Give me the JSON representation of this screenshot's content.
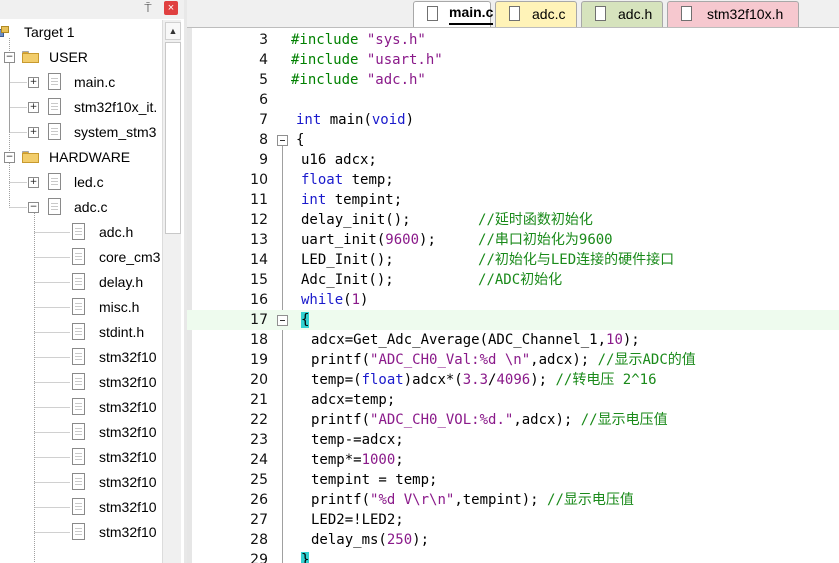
{
  "project_panel": {
    "pin_glyph": "⍑",
    "close_glyph": "×",
    "target": "Target 1",
    "groups": [
      {
        "name": "USER",
        "files": [
          "main.c",
          "stm32f10x_it.",
          "system_stm3"
        ]
      },
      {
        "name": "HARDWARE",
        "files": [
          "led.c",
          "adc.c"
        ]
      }
    ],
    "adc_children": [
      "adc.h",
      "core_cm3",
      "delay.h",
      "misc.h",
      "stdint.h",
      "stm32f10",
      "stm32f10",
      "stm32f10",
      "stm32f10",
      "stm32f10",
      "stm32f10",
      "stm32f10",
      "stm32f10"
    ]
  },
  "tabs": [
    {
      "label": "main.c",
      "active": true,
      "color": "#ffffff"
    },
    {
      "label": "adc.c",
      "active": false,
      "color": "#fff3b8"
    },
    {
      "label": "adc.h",
      "active": false,
      "color": "#d6e3bd"
    },
    {
      "label": "stm32f10x.h",
      "active": false,
      "color": "#f6c8cf"
    }
  ],
  "editor": {
    "highlighted_line": "17",
    "lines": [
      {
        "num": "3",
        "fold": false,
        "indent": 0,
        "parts": [
          [
            "pp",
            "#include "
          ],
          [
            "s",
            "\"sys.h\""
          ]
        ]
      },
      {
        "num": "4",
        "fold": false,
        "indent": 0,
        "parts": [
          [
            "pp",
            "#include "
          ],
          [
            "s",
            "\"usart.h\""
          ]
        ]
      },
      {
        "num": "5",
        "fold": false,
        "indent": 0,
        "parts": [
          [
            "pp",
            "#include "
          ],
          [
            "s",
            "\"adc.h\""
          ]
        ]
      },
      {
        "num": "6",
        "fold": false,
        "indent": 0,
        "parts": []
      },
      {
        "num": "7",
        "fold": false,
        "indent": 1,
        "parts": [
          [
            "k",
            "int"
          ],
          [
            "",
            " main("
          ],
          [
            "k",
            "void"
          ],
          [
            "",
            ")"
          ]
        ]
      },
      {
        "num": "8",
        "fold": true,
        "indent": 1,
        "parts": [
          [
            "",
            "{"
          ]
        ]
      },
      {
        "num": "9",
        "fold": false,
        "indent": 2,
        "parts": [
          [
            "",
            "u16 adcx;"
          ]
        ]
      },
      {
        "num": "10",
        "fold": false,
        "indent": 2,
        "parts": [
          [
            "k",
            "float"
          ],
          [
            "",
            " temp;"
          ]
        ]
      },
      {
        "num": "11",
        "fold": false,
        "indent": 2,
        "parts": [
          [
            "k",
            "int"
          ],
          [
            "",
            " tempint;"
          ]
        ]
      },
      {
        "num": "12",
        "fold": false,
        "indent": 2,
        "parts": [
          [
            "",
            "delay_init();        "
          ],
          [
            "c",
            "//延时函数初始化"
          ]
        ]
      },
      {
        "num": "13",
        "fold": false,
        "indent": 2,
        "parts": [
          [
            "",
            "uart_init("
          ],
          [
            "n",
            "9600"
          ],
          [
            "",
            ");     "
          ],
          [
            "c",
            "//串口初始化为9600"
          ]
        ]
      },
      {
        "num": "14",
        "fold": false,
        "indent": 2,
        "parts": [
          [
            "",
            "LED_Init();          "
          ],
          [
            "c",
            "//初始化与LED连接的硬件接口"
          ]
        ]
      },
      {
        "num": "15",
        "fold": false,
        "indent": 2,
        "parts": [
          [
            "",
            "Adc_Init();          "
          ],
          [
            "c",
            "//ADC初始化"
          ]
        ]
      },
      {
        "num": "16",
        "fold": false,
        "indent": 2,
        "parts": [
          [
            "k",
            "while"
          ],
          [
            "",
            "("
          ],
          [
            "n",
            "1"
          ],
          [
            "",
            ")"
          ]
        ]
      },
      {
        "num": "17",
        "fold": true,
        "indent": 2,
        "parts": [
          [
            "brace",
            "{"
          ]
        ]
      },
      {
        "num": "18",
        "fold": false,
        "indent": 4,
        "parts": [
          [
            "",
            "adcx=Get_Adc_Average(ADC_Channel_1,"
          ],
          [
            "n",
            "10"
          ],
          [
            "",
            ");"
          ]
        ]
      },
      {
        "num": "19",
        "fold": false,
        "indent": 4,
        "parts": [
          [
            "",
            "printf("
          ],
          [
            "s",
            "\"ADC_CH0_Val:%d \\n\""
          ],
          [
            "",
            ",adcx); "
          ],
          [
            "c",
            "//显示ADC的值"
          ]
        ]
      },
      {
        "num": "20",
        "fold": false,
        "indent": 4,
        "parts": [
          [
            "",
            "temp=("
          ],
          [
            "k",
            "float"
          ],
          [
            "",
            ")adcx*("
          ],
          [
            "n",
            "3.3"
          ],
          [
            "",
            "/"
          ],
          [
            "n",
            "4096"
          ],
          [
            "",
            "); "
          ],
          [
            "c",
            "//转电压 2^16"
          ]
        ]
      },
      {
        "num": "21",
        "fold": false,
        "indent": 4,
        "parts": [
          [
            "",
            "adcx=temp;"
          ]
        ]
      },
      {
        "num": "22",
        "fold": false,
        "indent": 4,
        "parts": [
          [
            "",
            "printf("
          ],
          [
            "s",
            "\"ADC_CH0_VOL:%d.\""
          ],
          [
            "",
            ",adcx); "
          ],
          [
            "c",
            "//显示电压值"
          ]
        ]
      },
      {
        "num": "23",
        "fold": false,
        "indent": 4,
        "parts": [
          [
            "",
            "temp-=adcx;"
          ]
        ]
      },
      {
        "num": "24",
        "fold": false,
        "indent": 4,
        "parts": [
          [
            "",
            "temp*="
          ],
          [
            "n",
            "1000"
          ],
          [
            "",
            ";"
          ]
        ]
      },
      {
        "num": "25",
        "fold": false,
        "indent": 4,
        "parts": [
          [
            "",
            "tempint = temp;"
          ]
        ]
      },
      {
        "num": "26",
        "fold": false,
        "indent": 4,
        "parts": [
          [
            "",
            "printf("
          ],
          [
            "s",
            "\"%d V\\r\\n\""
          ],
          [
            "",
            ",tempint); "
          ],
          [
            "c",
            "//显示电压值"
          ]
        ]
      },
      {
        "num": "27",
        "fold": false,
        "indent": 4,
        "parts": [
          [
            "",
            "LED2=!LED2;"
          ]
        ]
      },
      {
        "num": "28",
        "fold": false,
        "indent": 4,
        "parts": [
          [
            "",
            "delay_ms("
          ],
          [
            "n",
            "250"
          ],
          [
            "",
            ");"
          ]
        ]
      },
      {
        "num": "29",
        "fold": false,
        "indent": 2,
        "parts": [
          [
            "brace",
            "}"
          ]
        ]
      }
    ]
  }
}
